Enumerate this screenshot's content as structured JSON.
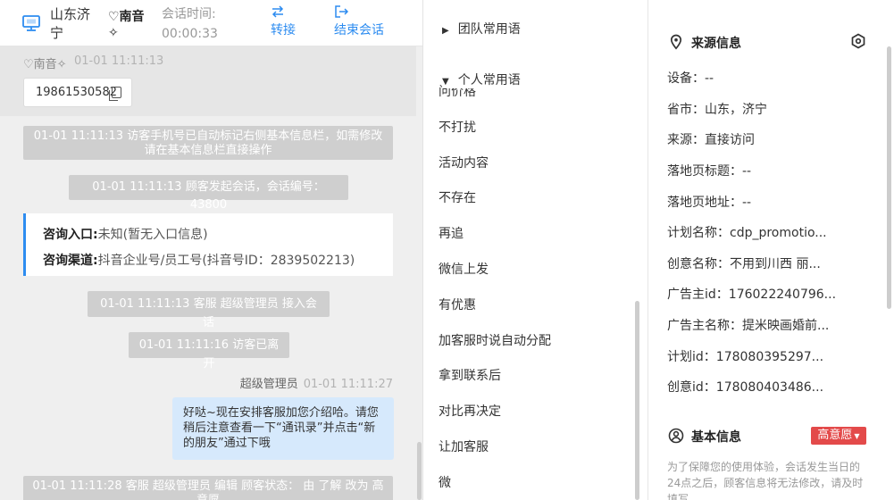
{
  "chat": {
    "header": {
      "city": "山东济宁",
      "nickname": "♡南音✧",
      "time_label": "会话时间:",
      "time_value": "00:00:33",
      "transfer_label": "转接",
      "end_label": "结束会话"
    },
    "visitor": {
      "nickname": "♡南音✧",
      "time": "01-01 11:11:13",
      "phone": "19861530582"
    },
    "system_messages": [
      "01-01 11:11:13 访客手机号已自动标记右侧基本信息栏，如需修改请在基本信息栏直接操作",
      "01-01 11:11:13 顾客发起会话，会话编号：43800",
      "01-01 11:11:13 客服 超级管理员 接入会话",
      "01-01 11:11:16 访客已离开",
      "01-01 11:11:28 客服 超级管理员 编辑 顾客状态： 由 了解 改为 高意愿"
    ],
    "consult": {
      "entry_label": "咨询入口:",
      "entry_value": "未知(暂无入口信息)",
      "channel_label": "咨询渠道:",
      "channel_value": "抖音企业号/员工号(抖音号ID：2839502213)"
    },
    "agent_message": {
      "name": "超级管理员",
      "time": "01-01 11:11:27",
      "text": "好哒~现在安排客服加您介绍哈。请您稍后注意查看一下“通讯录”并点击“新的朋友”通过下哦"
    }
  },
  "phrases": {
    "team_group": "团队常用语",
    "personal_group": "个人常用语",
    "items": [
      "问价格",
      "不打扰",
      "活动内容",
      "不存在",
      "再追",
      "微信上发",
      "有优惠",
      "加客服时说自动分配",
      "拿到联系后",
      "对比再决定",
      "让加客服",
      "微"
    ]
  },
  "info": {
    "source_title": "来源信息",
    "rows": [
      {
        "label": "设备：",
        "value": "--"
      },
      {
        "label": "省市：",
        "value": "山东，济宁"
      },
      {
        "label": "来源：",
        "value": "直接访问"
      },
      {
        "label": "落地页标题：",
        "value": "--"
      },
      {
        "label": "落地页地址：",
        "value": "--"
      },
      {
        "label": "计划名称：",
        "value": "cdp_promotio..."
      },
      {
        "label": "创意名称：",
        "value": "不用到川西 丽..."
      },
      {
        "label": "广告主id：",
        "value": "176022240796..."
      },
      {
        "label": "广告主名称：",
        "value": "提米映画婚前..."
      },
      {
        "label": "计划id：",
        "value": "178080395297..."
      },
      {
        "label": "创意id：",
        "value": "178080403486..."
      }
    ],
    "basic_title": "基本信息",
    "intent_badge": "高意愿",
    "basic_note": "为了保障您的使用体验，会话发生当日的24点之后，顾客信息将无法修改，请及时填写"
  },
  "colors": {
    "accent": "#2d8cf0",
    "badge_red": "#e34a4a",
    "agent_bubble": "#d6e9fc",
    "system_bubble": "#cfcfcf"
  },
  "icons": [
    "monitor-icon",
    "transfer-icon",
    "end-session-icon",
    "copy-icon",
    "location-icon",
    "settings-icon",
    "user-icon",
    "caret-down-icon"
  ]
}
